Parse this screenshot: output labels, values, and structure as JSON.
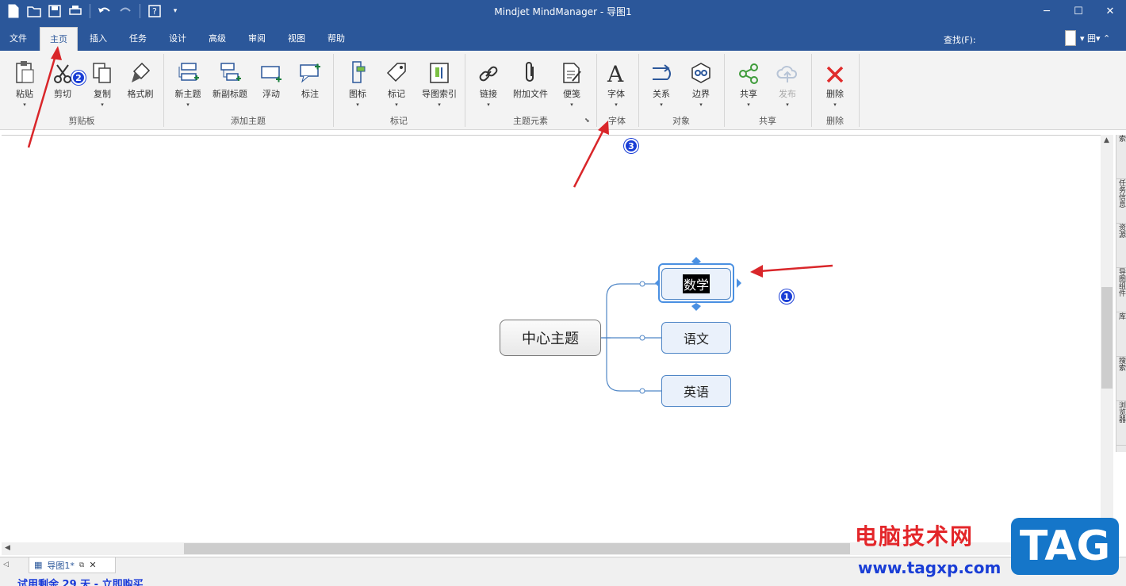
{
  "window": {
    "title": "Mindjet MindManager - 导图1"
  },
  "tabs": [
    "文件",
    "主页",
    "插入",
    "任务",
    "设计",
    "高级",
    "审阅",
    "视图",
    "帮助"
  ],
  "find_label": "查找(F):",
  "ribbon": {
    "paste": "粘贴",
    "cut": "剪切",
    "copy": "复制",
    "format_painter": "格式刷",
    "new_topic": "新主题",
    "new_subtopic": "新副标题",
    "floating": "浮动",
    "callout": "标注",
    "icon": "图标",
    "tag": "标记",
    "map_index": "导图索引",
    "link": "链接",
    "attach": "附加文件",
    "notes": "便笺",
    "font": "字体",
    "relationship": "关系",
    "boundary": "边界",
    "share": "共享",
    "publish": "发布",
    "delete": "删除",
    "groups": {
      "clipboard": "剪贴板",
      "add_topic": "添加主题",
      "markers": "标记",
      "topic_elements": "主题元素",
      "font": "字体",
      "objects": "对象",
      "share": "共享",
      "delete": "删除"
    }
  },
  "map": {
    "central": "中心主题",
    "topics": [
      "数学",
      "语文",
      "英语"
    ]
  },
  "badges": [
    "1",
    "2",
    "3"
  ],
  "side_panel": [
    "索",
    "任务信息",
    "资源",
    "导图组件",
    "库",
    "搜索",
    "浏览器"
  ],
  "doc_tab": "导图1*",
  "status": {
    "trial": "试用剩余 29 天 - 立即购买"
  },
  "watermark": {
    "cn": "电脑技术网",
    "url": "www.tagxp.com",
    "logo": "TAG"
  },
  "colors": {
    "accent": "#2b579a",
    "arrow": "#d9262a",
    "badge": "#1a3ed6"
  }
}
